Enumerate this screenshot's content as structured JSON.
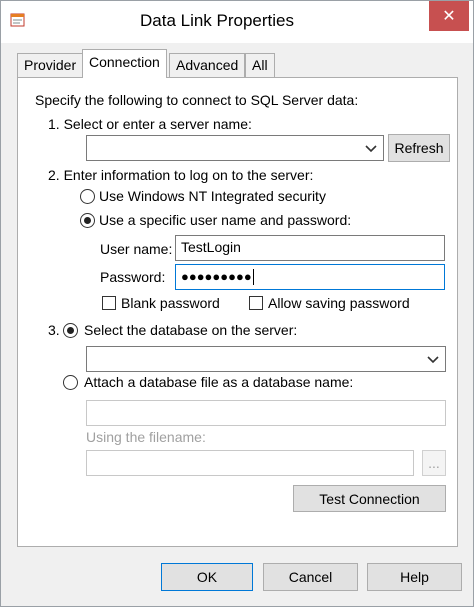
{
  "window": {
    "title": "Data Link Properties",
    "close_glyph": "✕"
  },
  "tabs": [
    {
      "label": "Provider",
      "active": false
    },
    {
      "label": "Connection",
      "active": true
    },
    {
      "label": "Advanced",
      "active": false
    },
    {
      "label": "All",
      "active": false
    }
  ],
  "connection": {
    "intro": "Specify the following to connect to SQL Server data:",
    "step1_label": "1. Select or enter a server name:",
    "server_value": "",
    "refresh_label": "Refresh",
    "step2_label": "2. Enter information to log on to the server:",
    "auth_windows_label": "Use Windows NT Integrated security",
    "auth_specific_label": "Use a specific user name and password:",
    "username_label": "User name:",
    "username_value": "TestLogin",
    "password_label": "Password:",
    "password_value": "●●●●●●●●●",
    "blank_password_label": "Blank password",
    "allow_saving_label": "Allow saving password",
    "step3_label": "3.",
    "select_db_label": "Select the database on the server:",
    "database_value": "",
    "attach_db_label": "Attach a database file as a database name:",
    "attach_db_value": "",
    "filename_label": "Using the filename:",
    "filename_value": "",
    "browse_label": "...",
    "test_connection_label": "Test Connection"
  },
  "footer": {
    "ok_label": "OK",
    "cancel_label": "Cancel",
    "help_label": "Help"
  }
}
